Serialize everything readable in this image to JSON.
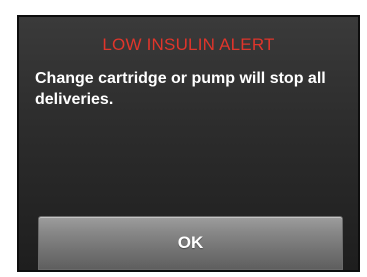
{
  "alert": {
    "title": "LOW INSULIN ALERT",
    "title_color": "#e0352b",
    "message": "Change cartridge or pump will stop all deliveries.",
    "ok_label": "OK"
  }
}
